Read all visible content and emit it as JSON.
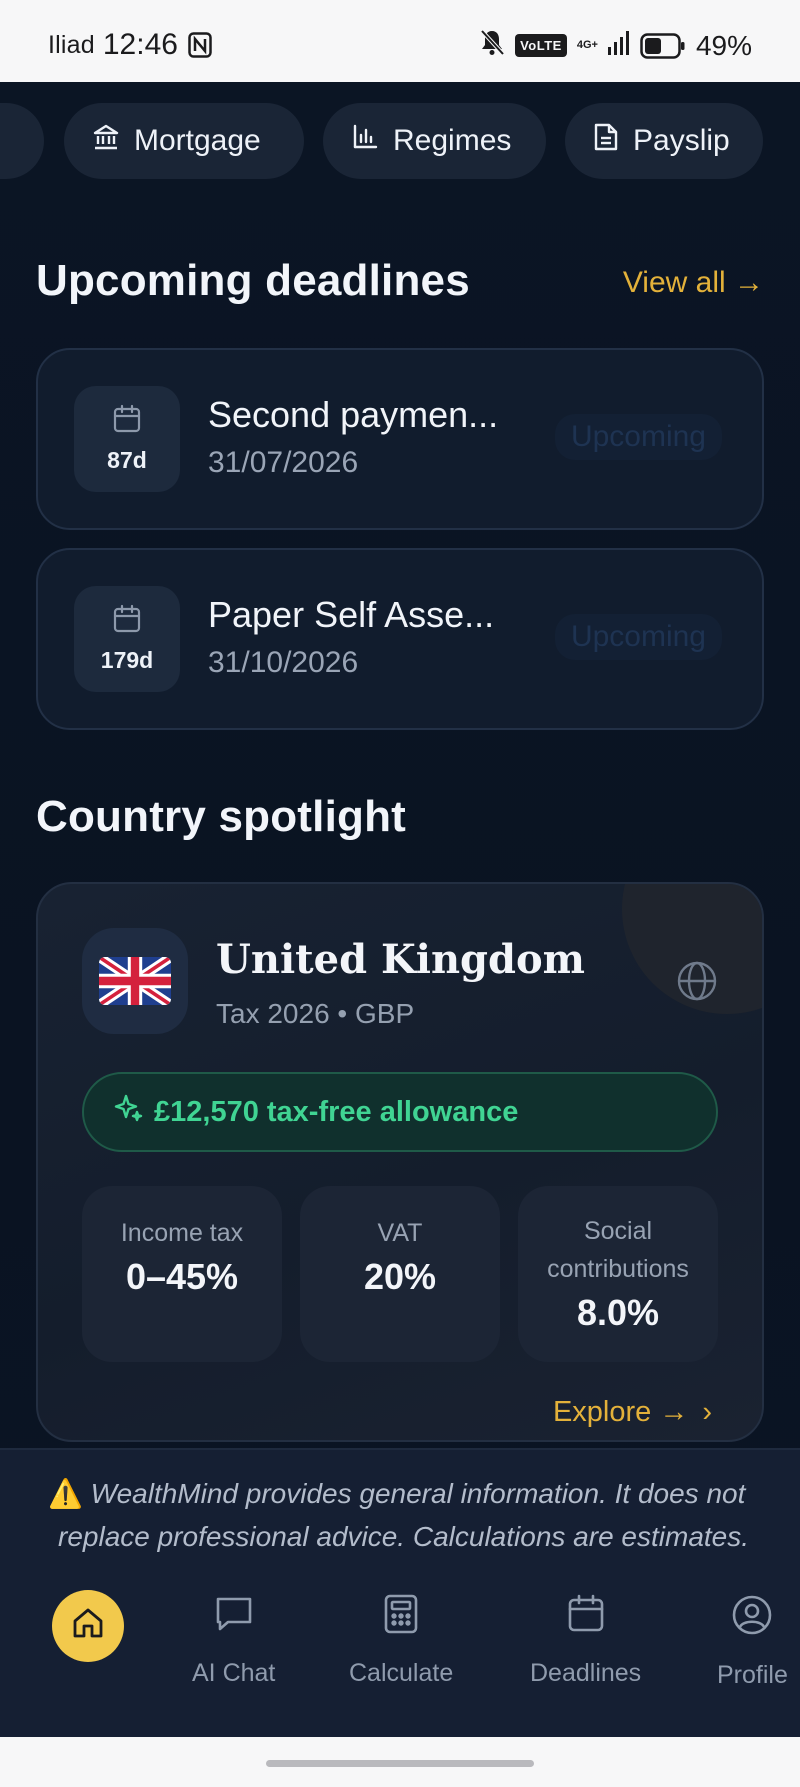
{
  "status_bar": {
    "carrier": "Iliad",
    "time": "12:46",
    "network_badge": "VoLTE",
    "network_gen": "4G+",
    "battery": "49%"
  },
  "tools": [
    {
      "label": "Mortgage",
      "icon": "bank-icon"
    },
    {
      "label": "Regimes",
      "icon": "bar-chart-icon"
    },
    {
      "label": "Payslip",
      "icon": "document-icon"
    }
  ],
  "deadlines": {
    "title": "Upcoming deadlines",
    "view_all": "View all →",
    "items": [
      {
        "days": "87d",
        "title": "Second paymen...",
        "date": "31/07/2026",
        "status": "Upcoming"
      },
      {
        "days": "179d",
        "title": "Paper Self Asse...",
        "date": "31/10/2026",
        "status": "Upcoming"
      }
    ]
  },
  "spotlight": {
    "title": "Country spotlight",
    "country": "United Kingdom",
    "meta": "Tax 2026 • GBP",
    "allowance": "£12,570 tax-free allowance",
    "stats": [
      {
        "label": "Income tax",
        "value": "0–45%"
      },
      {
        "label": "VAT",
        "value": "20%"
      },
      {
        "label_line1": "Social",
        "label_line2": "contributions",
        "value": "8.0%"
      }
    ],
    "explore": "Explore →",
    "explore_chevron": "›"
  },
  "disclaimer": {
    "icon": "⚠️",
    "line1": "WealthMind provides general information. It does not",
    "line2": "replace professional advice. Calculations are estimates."
  },
  "nav": {
    "items": [
      {
        "label": "",
        "icon": "home-icon",
        "active": true
      },
      {
        "label": "AI Chat",
        "icon": "chat-icon"
      },
      {
        "label": "Calculate",
        "icon": "calculator-icon"
      },
      {
        "label": "Deadlines",
        "icon": "calendar-icon"
      },
      {
        "label": "Profile",
        "icon": "user-circle-icon"
      }
    ]
  },
  "colors": {
    "background": "#0b1322",
    "card": "#111c2d",
    "accent_gold": "#e3b13a",
    "home_active": "#f2c94c",
    "allowance_green": "#40d493"
  }
}
